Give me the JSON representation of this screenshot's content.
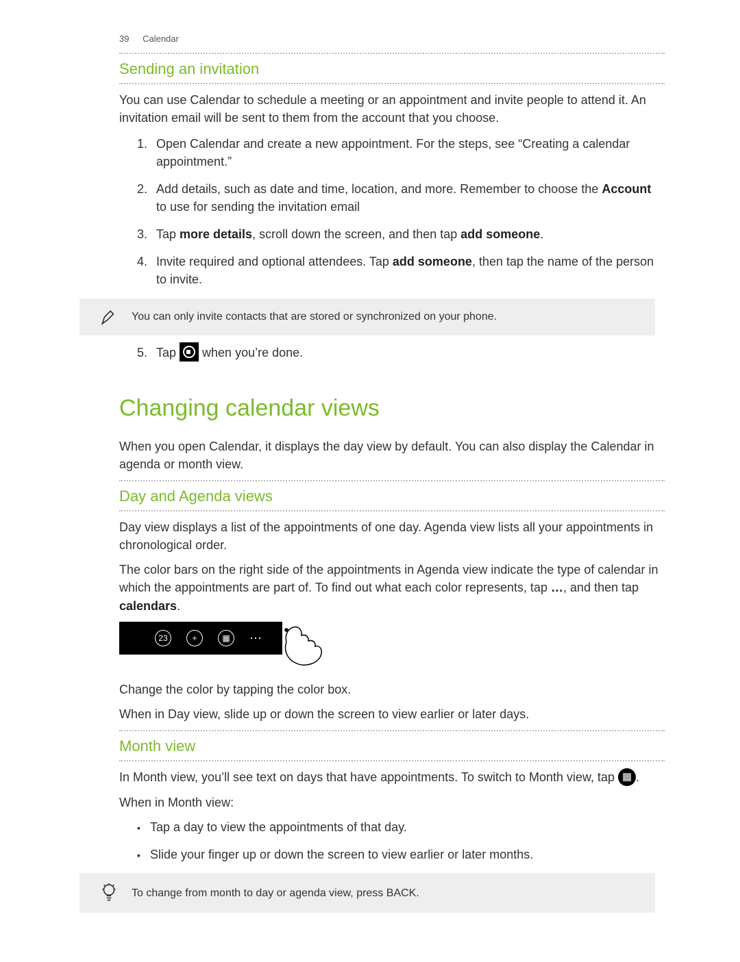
{
  "header": {
    "page_number": "39",
    "section": "Calendar"
  },
  "h_sending": "Sending an invitation",
  "p_sending_intro": "You can use Calendar to schedule a meeting or an appointment and invite people to attend it. An invitation email will be sent to them from the account that you choose.",
  "steps": {
    "s1": "Open Calendar and create a new appointment. For the steps, see “Creating a calendar appointment.”",
    "s2a": "Add details, such as date and time, location, and more. Remember to choose the ",
    "s2b_bold": "Account",
    "s2c": " to use for sending the invitation email",
    "s3a": "Tap ",
    "s3b_bold": "more details",
    "s3c": ", scroll down the screen, and then tap ",
    "s3d_bold": "add someone",
    "s3e": ".",
    "s4a": "Invite required and optional attendees. Tap ",
    "s4b_bold": "add someone",
    "s4c": ", then tap the name of the person to invite.",
    "s5a": "Tap ",
    "s5c": " when you’re done."
  },
  "note1": "You can only invite contacts that are stored or synchronized on your phone.",
  "h_changing": "Changing calendar views",
  "p_changing_intro": "When you open Calendar, it displays the day view by default. You can also display the Calendar in agenda or month view.",
  "h_day_agenda": "Day and Agenda views",
  "p_day1": "Day view displays a list of the appointments of one day. Agenda view lists all your appointments in chronological order.",
  "p_day2a": "The color bars on the right side of the appointments in Agenda view indicate the type of calendar in which the appointments are part of. To find out what each color represents, tap ",
  "p_day2_dots": "…",
  "p_day2b": ", and then tap ",
  "p_day2_bold": "calendars",
  "p_day2c": ".",
  "p_color": "Change the color by tapping the color box.",
  "p_slide": "When in Day view, slide up or down the screen to view earlier or later days.",
  "h_month": "Month view",
  "p_month1a": "In Month view, you’ll see text on days that have appointments. To switch to Month view, tap ",
  "p_month1b": ".",
  "p_month2": "When in Month view:",
  "bullets": {
    "b1": "Tap a day to view the appointments of that day.",
    "b2": "Slide your finger up or down the screen to view earlier or later months."
  },
  "tip": "To change from month to day or agenda view, press BACK."
}
